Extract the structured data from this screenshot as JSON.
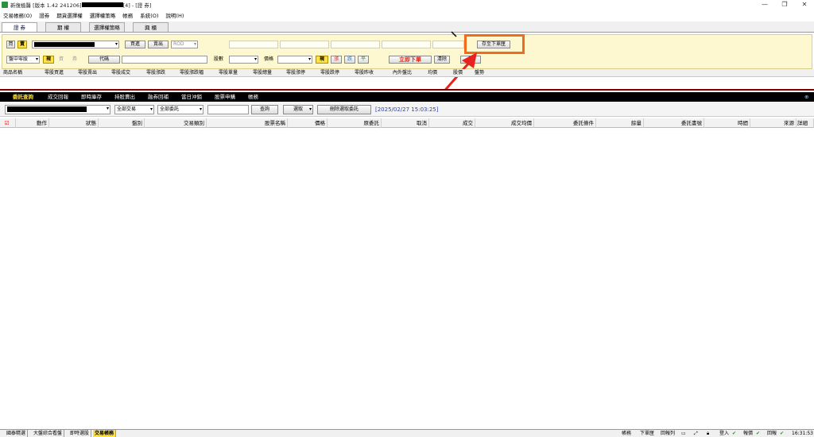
{
  "window": {
    "title_prefix": "新復植醫 [版本 1.42 241206]",
    "title_suffix": "[4] - [證 券]",
    "controls": {
      "minimize": "—",
      "maximize": "❐",
      "close": "✕"
    }
  },
  "menu": [
    "交易帳務(O)",
    "證券",
    "期貨選擇權",
    "選擇權策略",
    "帳務",
    "系統(O)",
    "說明(H)"
  ],
  "product_tabs": [
    "證 券",
    "期 權",
    "選擇權策略",
    "興 櫃"
  ],
  "order_panel": {
    "buy_mark": "買",
    "sell_mark": "賣",
    "buy_btn": "買進",
    "sell_btn": "賣出",
    "tif": "ROD",
    "market_select": "盤中零股",
    "cash_label": "現",
    "margin_label": "資",
    "short_label": "券",
    "code_btn": "代碼",
    "shares_label": "股數",
    "price_label": "價格",
    "price_type": "現",
    "limit_up": "漲",
    "limit_down": "跌",
    "flat": "平",
    "submit_btn": "立即下單",
    "clear_btn": "清除",
    "save_btn": "存至下單匣",
    "extra_btn": "提"
  },
  "quote_headers": [
    "商品名稱",
    "零股買進",
    "零股賣出",
    "零股成交",
    "零股漲跌",
    "零股漲跌幅",
    "零股單量",
    "零股總量",
    "零股漲停",
    "零股跌停",
    "零股昨收",
    "內外盤比",
    "均價",
    "股價",
    "盤勢"
  ],
  "query_tabs": [
    "委託查詢",
    "成交回報",
    "即時庫存",
    "持股賣出",
    "融券回補",
    "當日沖銷",
    "股票申購",
    "帳務"
  ],
  "query_toolbar": {
    "trade_type": "全部交易",
    "order_filter": "全部委託",
    "query_btn": "查詢",
    "select_btn": "選取",
    "delete_btn": "刪除選取委託",
    "timestamp": "[2025/02/27 15:03:25]"
  },
  "grid_headers": [
    "動作",
    "狀態",
    "盤別",
    "交易類別",
    "股票名稱",
    "價格",
    "原委託",
    "取消",
    "成交",
    "成交均價",
    "委託條件",
    "餘量",
    "委託書號",
    "時間",
    "來源",
    "詳細"
  ],
  "bottom_tabs": [
    "國泰精選",
    "大盤綜合看盤",
    "即時選股",
    "交易帳務"
  ],
  "status_items": [
    "帳務",
    "下單匣",
    "回報列",
    "登入",
    "報價",
    "回報",
    "16:31:53"
  ],
  "colors": {
    "panel_bg": "#fdf8cf",
    "highlight": "#f26a1b",
    "arrow": "#e8231f",
    "active_tab": "#ffe24a",
    "timestamp": "#2b3fbf"
  }
}
